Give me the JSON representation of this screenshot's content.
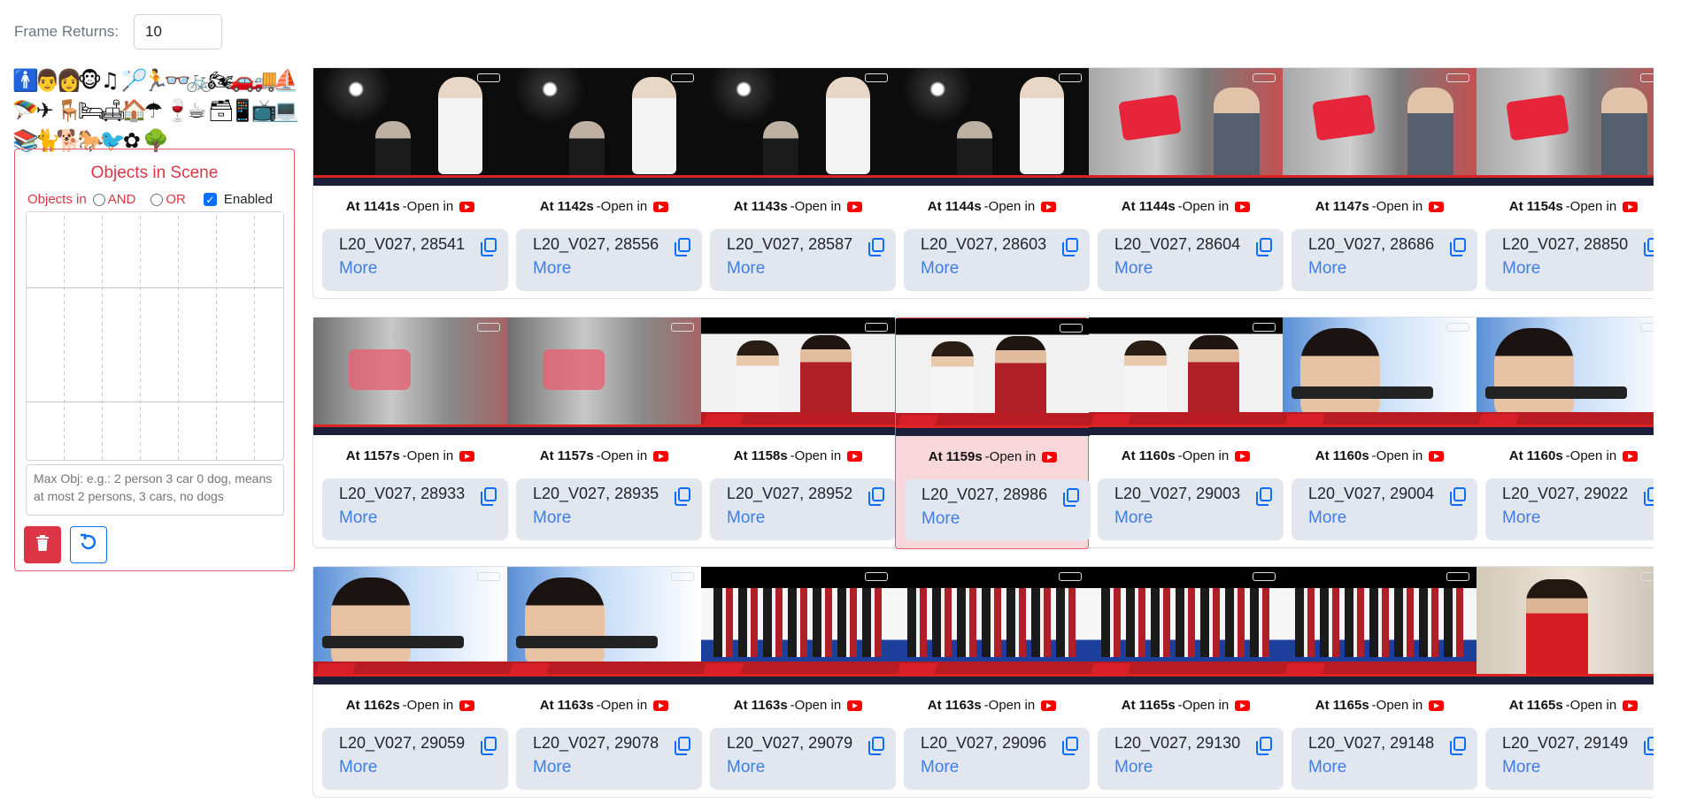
{
  "frame_returns": {
    "label": "Frame Returns:",
    "value": "10"
  },
  "palette": [
    "🚹",
    "👨",
    "👩",
    "🐵",
    "♫",
    "🏸",
    "🏃",
    "👓",
    "🚲",
    "🏍",
    "🚗",
    "🚚",
    "⛵",
    "🪂",
    "✈",
    "🪑",
    "🛏",
    "🛋",
    "🏠",
    "☂",
    "🍷",
    "☕",
    "🗃",
    "📱",
    "📺",
    "💻",
    "📚",
    "🐈",
    "🐕",
    "🐎",
    "🐦",
    "✿",
    "🌳"
  ],
  "palette_names": [
    "person",
    "man",
    "woman",
    "monkey",
    "music",
    "racket",
    "runner",
    "glasses",
    "bicycle",
    "motorcycle",
    "car",
    "truck",
    "boat",
    "parachute",
    "airplane",
    "chair",
    "bed",
    "sofa",
    "house",
    "umbrella",
    "wine",
    "cup",
    "cabinet",
    "phone",
    "tv",
    "laptop",
    "books",
    "cat",
    "dog",
    "horse",
    "bird",
    "flower",
    "tree"
  ],
  "objects_panel": {
    "title": "Objects in Scene",
    "objects_in_label": "Objects in",
    "and_label": "AND",
    "or_label": "OR",
    "enabled_label": "Enabled",
    "max_obj_placeholder": "Max Obj: e.g.: 2 person 3 car 0 dog, means at most 2 persons, 3 cars, no dogs"
  },
  "open_in": "-Open in",
  "more_label": "More",
  "rows": [
    [
      {
        "time": "At 1141s",
        "video": "L20_V027, 28541",
        "thumb": "concert"
      },
      {
        "time": "At 1142s",
        "video": "L20_V027, 28556",
        "thumb": "concert"
      },
      {
        "time": "At 1143s",
        "video": "L20_V027, 28587",
        "thumb": "concert"
      },
      {
        "time": "At 1144s",
        "video": "L20_V027, 28603",
        "thumb": "concert"
      },
      {
        "time": "At 1144s",
        "video": "L20_V027, 28604",
        "thumb": "studio"
      },
      {
        "time": "At 1147s",
        "video": "L20_V027, 28686",
        "thumb": "studio"
      },
      {
        "time": "At 1154s",
        "video": "L20_V027, 28850",
        "thumb": "studio"
      }
    ],
    [
      {
        "time": "At 1157s",
        "video": "L20_V027, 28933",
        "thumb": "fade"
      },
      {
        "time": "At 1157s",
        "video": "L20_V027, 28935",
        "thumb": "fade"
      },
      {
        "time": "At 1158s",
        "video": "L20_V027, 28952",
        "thumb": "duo"
      },
      {
        "time": "At 1159s",
        "video": "L20_V027, 28986",
        "thumb": "duo",
        "selected": true
      },
      {
        "time": "At 1160s",
        "video": "L20_V027, 29003",
        "thumb": "duo"
      },
      {
        "time": "At 1160s",
        "video": "L20_V027, 29004",
        "thumb": "aim"
      },
      {
        "time": "At 1160s",
        "video": "L20_V027, 29022",
        "thumb": "aim"
      }
    ],
    [
      {
        "time": "At 1162s",
        "video": "L20_V027, 29059",
        "thumb": "aim"
      },
      {
        "time": "At 1163s",
        "video": "L20_V027, 29078",
        "thumb": "aim"
      },
      {
        "time": "At 1163s",
        "video": "L20_V027, 29079",
        "thumb": "team"
      },
      {
        "time": "At 1163s",
        "video": "L20_V027, 29096",
        "thumb": "team"
      },
      {
        "time": "At 1165s",
        "video": "L20_V027, 29130",
        "thumb": "team"
      },
      {
        "time": "At 1165s",
        "video": "L20_V027, 29148",
        "thumb": "team"
      },
      {
        "time": "At 1165s",
        "video": "L20_V027, 29149",
        "thumb": "red"
      }
    ]
  ],
  "colors": {
    "accent_red": "#dc3545",
    "link_blue": "#3d7ee8",
    "primary_blue": "#0d6efd",
    "info_bg": "#e2e6ee"
  }
}
